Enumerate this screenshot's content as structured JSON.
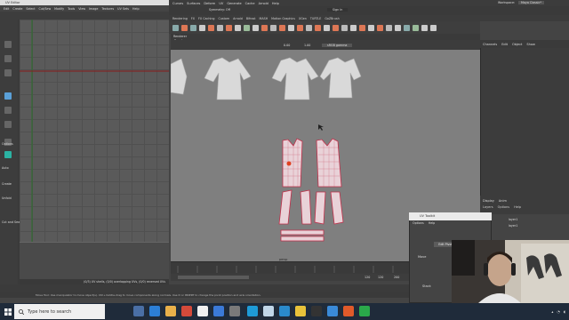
{
  "maya": {
    "menubar": [
      "Curves",
      "Surfaces",
      "Deform",
      "UV",
      "Generate",
      "Cache",
      "Arnold",
      "Help"
    ],
    "symmetry": "Symmetry: Off",
    "sign_in": "Sign In",
    "workspace_label": "Workspace:",
    "workspace_value": "Maya Classic*",
    "shelf_tabs": [
      "Rendering",
      "FX",
      "FX Caching",
      "Custom",
      "Arnold",
      "Bifrost",
      "MASH",
      "Motion Graphics",
      "XGen",
      "TURTLE",
      "GoZBrush"
    ],
    "viewport_menu": [
      "Renderer",
      "Panels"
    ],
    "viewport_values": [
      "0.00",
      "1.00",
      "sRGB gamma"
    ],
    "selected_label": "persp",
    "help_line": "Move Tool: Use manipulator to move object(s). Ctrl+middle-drag to move components along normals. Use D or INSERT to change the pivot position and axis orientation.",
    "range_values": [
      "120",
      "120",
      "200"
    ],
    "accent": "#5aa0d8"
  },
  "channel_box": {
    "tabs": [
      "Channels",
      "Edit",
      "Object",
      "Show"
    ]
  },
  "layers": {
    "tabs": [
      "Display",
      "Anim"
    ],
    "menu": [
      "Layers",
      "Options",
      "Help"
    ],
    "items": [
      "layer1",
      "layer1"
    ]
  },
  "uv_editor": {
    "title": "UV Editor",
    "menubar": [
      "Edit",
      "Create",
      "Select",
      "Cut/Sew",
      "Modify",
      "Tools",
      "View",
      "Image",
      "Textures",
      "UV Sets",
      "Help"
    ],
    "status": "(0/3) UV shells, (0/0) overlapping UVs, (0/0) reversed UVs",
    "side_labels": [
      "Options",
      "Auto",
      "Create",
      "Unfold",
      "Cut and Sew"
    ]
  },
  "uv_toolkit": {
    "title": "UV Toolkit",
    "menu": [
      "Options",
      "Help"
    ],
    "buttons": [
      "Edit Pivot",
      "Reset"
    ],
    "move_label": "Move",
    "stack_label": "Stack"
  },
  "taskbar": {
    "search_placeholder": "Type here to search"
  }
}
